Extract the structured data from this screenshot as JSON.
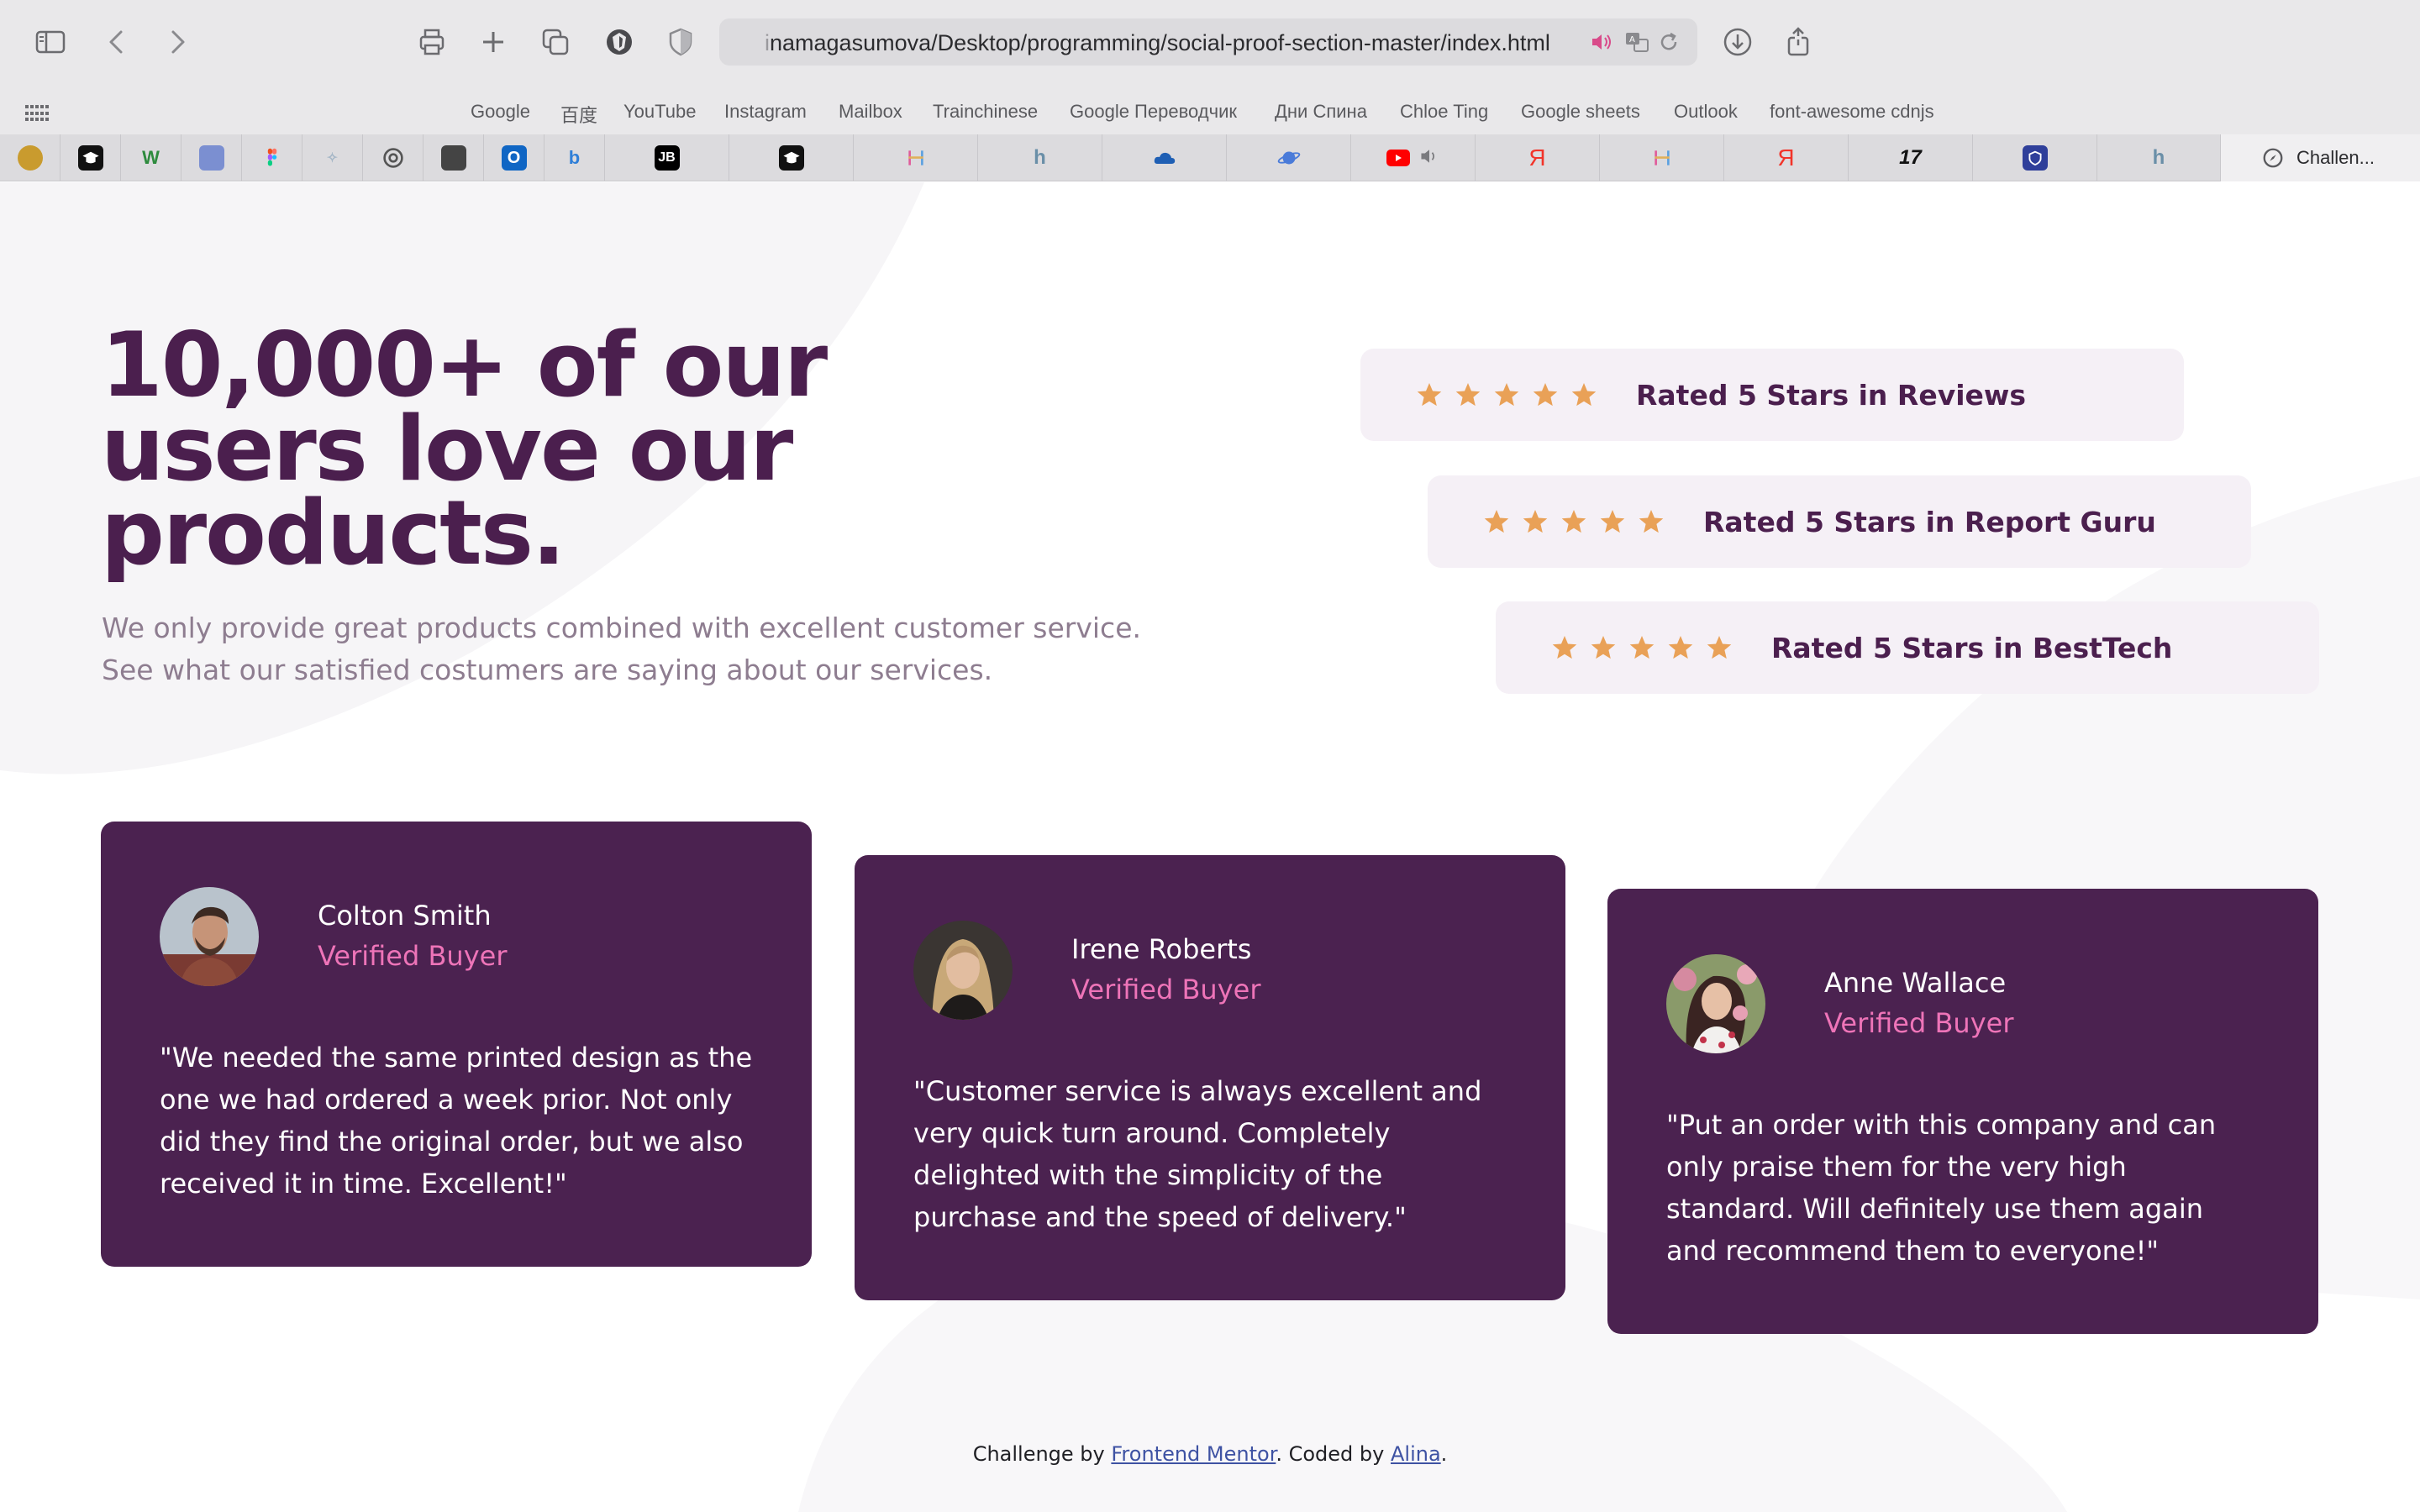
{
  "browser": {
    "url_dim": "i",
    "url": "namagasumova/Desktop/programming/social-proof-section-master/index.html",
    "favorites": [
      "Google",
      "百度",
      "YouTube",
      "Instagram",
      "Mailbox",
      "Trainchinese",
      "Google Переводчик",
      "Дни Спина",
      "Chloe Ting",
      "Google sheets",
      "Outlook",
      "font-awesome cdnjs"
    ],
    "active_tab_label": "Challen...",
    "tab_glyphs": {
      "jb": "JB",
      "h": "h",
      "ya": "Я",
      "seventeen": "17"
    }
  },
  "hero": {
    "title": "10,000+ of our users love our products.",
    "description": "We only provide great products combined with excellent customer service. See what our satisfied costumers are saying about our services."
  },
  "ratings": [
    {
      "stars": 5,
      "label": "Rated 5 Stars in Reviews"
    },
    {
      "stars": 5,
      "label": "Rated 5 Stars in Report Guru"
    },
    {
      "stars": 5,
      "label": "Rated 5 Stars in BestTech"
    }
  ],
  "testimonials": [
    {
      "name": "Colton Smith",
      "role": "Verified Buyer",
      "quote": "\"We needed the same printed design as the one we had ordered a week prior. Not only did they find the original order, but we also received it in time. Excellent!\""
    },
    {
      "name": "Irene Roberts",
      "role": "Verified Buyer",
      "quote": "\"Customer service is always excellent and very quick turn around. Completely delighted with the simplicity of the purchase and the speed of delivery.\""
    },
    {
      "name": "Anne Wallace",
      "role": "Verified Buyer",
      "quote": "\"Put an order with this company and can only praise them for the very high standard. Will definitely use them again and recommend them to everyone!\""
    }
  ],
  "footer": {
    "prefix": "Challenge by ",
    "link1": "Frontend Mentor",
    "middle": ". Coded by ",
    "link2": "Alina",
    "suffix": "."
  },
  "colors": {
    "dark_magenta": "#4b1f4e",
    "card_bg": "#4b2250",
    "pink": "#ee74b8",
    "star": "#e9a157",
    "rating_bg": "#f5f0f6"
  }
}
